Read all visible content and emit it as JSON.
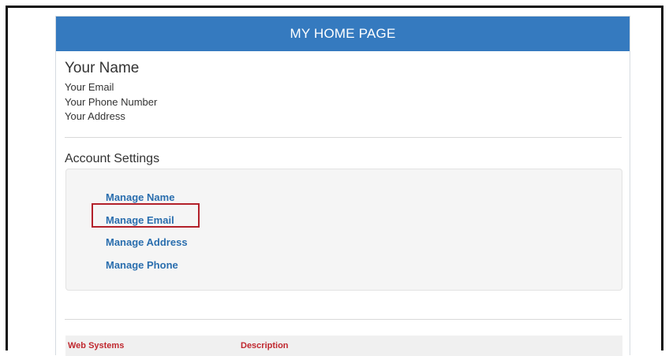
{
  "header": {
    "title": "MY HOME PAGE"
  },
  "profile": {
    "name": "Your Name",
    "email": "Your Email",
    "phone": "Your Phone Number",
    "address": "Your Address"
  },
  "account_settings": {
    "title": "Account Settings",
    "links": [
      "Manage Name",
      "Manage Email",
      "Manage Address",
      "Manage Phone"
    ],
    "highlighted": "Manage Email"
  },
  "table": {
    "columns": [
      "Web Systems",
      "Description"
    ]
  },
  "colors": {
    "header_bg": "#357abf",
    "link": "#2a6eae",
    "highlight_border": "#b3202a",
    "table_header_text": "#c0282f"
  }
}
